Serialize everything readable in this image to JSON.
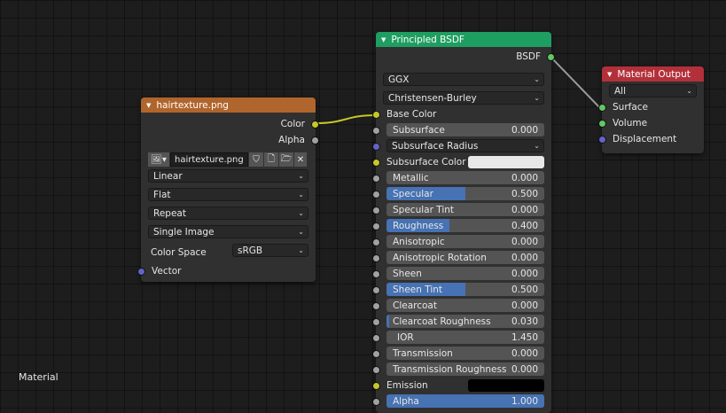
{
  "image_node": {
    "title": "hairtexture.png",
    "header_color": "#b0652c",
    "outputs": [
      "Color",
      "Alpha"
    ],
    "image_name": "hairtexture.png",
    "interpolation": "Linear",
    "projection": "Flat",
    "extension": "Repeat",
    "source": "Single Image",
    "color_space_label": "Color Space",
    "color_space_value": "sRGB",
    "input_vector": "Vector"
  },
  "bsdf_node": {
    "title": "Principled BSDF",
    "header_color": "#1f9e61",
    "output": "BSDF",
    "distribution": "GGX",
    "subsurface_method": "Christensen-Burley",
    "base_color_label": "Base Color",
    "fields": [
      {
        "label": "Subsurface",
        "value": "0.000",
        "fill": 0.0
      },
      {
        "label": "Subsurface Radius",
        "dropdown": true
      },
      {
        "label": "Subsurface Color",
        "color": "#e8e8e8"
      },
      {
        "label": "Metallic",
        "value": "0.000",
        "fill": 0.0
      },
      {
        "label": "Specular",
        "value": "0.500",
        "fill": 0.5
      },
      {
        "label": "Specular Tint",
        "value": "0.000",
        "fill": 0.0
      },
      {
        "label": "Roughness",
        "value": "0.400",
        "fill": 0.4
      },
      {
        "label": "Anisotropic",
        "value": "0.000",
        "fill": 0.0
      },
      {
        "label": "Anisotropic Rotation",
        "value": "0.000",
        "fill": 0.0
      },
      {
        "label": "Sheen",
        "value": "0.000",
        "fill": 0.0
      },
      {
        "label": "Sheen Tint",
        "value": "0.500",
        "fill": 0.5
      },
      {
        "label": "Clearcoat",
        "value": "0.000",
        "fill": 0.0
      },
      {
        "label": "Clearcoat Roughness",
        "value": "0.030",
        "fill": 0.03
      },
      {
        "label": "IOR",
        "value": "1.450",
        "fill": 0.0
      },
      {
        "label": "Transmission",
        "value": "0.000",
        "fill": 0.0
      },
      {
        "label": "Transmission Roughness",
        "value": "0.000",
        "fill": 0.0
      },
      {
        "label": "Emission",
        "color": "#000000"
      },
      {
        "label": "Alpha",
        "value": "1.000",
        "fill": 1.0
      }
    ]
  },
  "output_node": {
    "title": "Material Output",
    "header_color": "#b3303a",
    "target": "All",
    "inputs": [
      "Surface",
      "Volume",
      "Displacement"
    ]
  },
  "frame_label": "Material"
}
